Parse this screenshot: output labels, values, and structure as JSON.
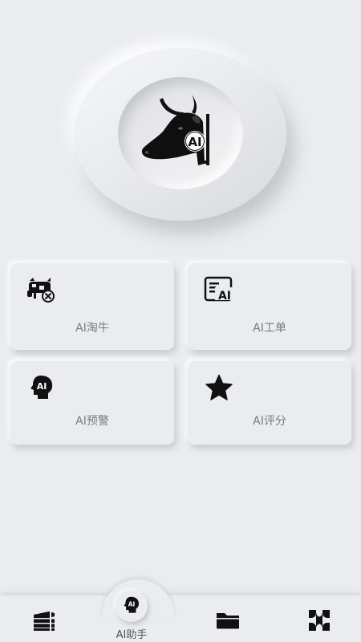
{
  "hero": {
    "logo_icon": "ai-bull-head-icon",
    "logo_badge_text": "AI"
  },
  "cards": [
    {
      "id": "taoniu",
      "label": "AI淘牛",
      "icon": "cattle-icon"
    },
    {
      "id": "gongdan",
      "label": "AI工单",
      "icon": "ai-document-icon"
    },
    {
      "id": "yujing",
      "label": "AI预警",
      "icon": "ai-head-icon",
      "icon_text": "AI"
    },
    {
      "id": "pingfen",
      "label": "AI评分",
      "icon": "star-icon"
    }
  ],
  "bottom_nav": {
    "items": [
      {
        "id": "home",
        "label": "",
        "icon": "stack-icon"
      },
      {
        "id": "assistant",
        "label": "AI助手",
        "icon": "ai-head-icon",
        "icon_text": "AI",
        "active": true
      },
      {
        "id": "files",
        "label": "",
        "icon": "folder-icon"
      },
      {
        "id": "apps",
        "label": "",
        "icon": "grid-cross-icon"
      }
    ]
  },
  "colors": {
    "background": "#ebecf0",
    "icon": "#111111",
    "label_text": "#7a7a7e"
  }
}
